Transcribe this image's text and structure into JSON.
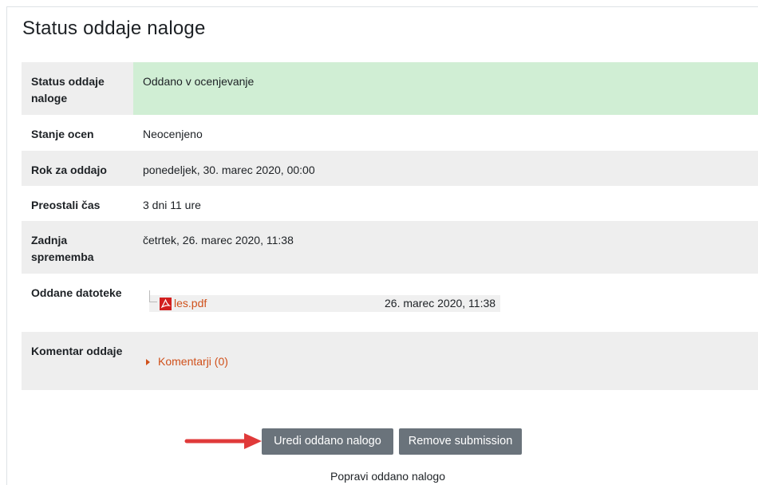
{
  "page": {
    "title": "Status oddaje naloge"
  },
  "status_table": {
    "submission_status": {
      "label": "Status oddaje naloge",
      "value": "Oddano v ocenjevanje"
    },
    "grading_status": {
      "label": "Stanje ocen",
      "value": "Neocenjeno"
    },
    "due_date": {
      "label": "Rok za oddajo",
      "value": "ponedeljek, 30. marec 2020, 00:00"
    },
    "time_remaining": {
      "label": "Preostali čas",
      "value": "3 dni 11 ure"
    },
    "last_modified": {
      "label": "Zadnja sprememba",
      "value": "četrtek, 26. marec 2020, 11:38"
    },
    "file_submissions": {
      "label": "Oddane datoteke",
      "file": {
        "name": "les.pdf",
        "date": "26. marec 2020, 11:38",
        "icon": "pdf-icon"
      }
    },
    "submission_comments": {
      "label": "Komentar oddaje",
      "toggle": "Komentarji (0)"
    }
  },
  "actions": {
    "edit_label": "Uredi oddano nalogo",
    "remove_label": "Remove submission",
    "hint": "Popravi oddano nalogo"
  },
  "colors": {
    "status_green": "#d0eed4",
    "row_grey": "#eeeeee",
    "link_orange": "#d0501a",
    "button_grey": "#6a737b",
    "annotation_arrow": "#e03a3a"
  }
}
